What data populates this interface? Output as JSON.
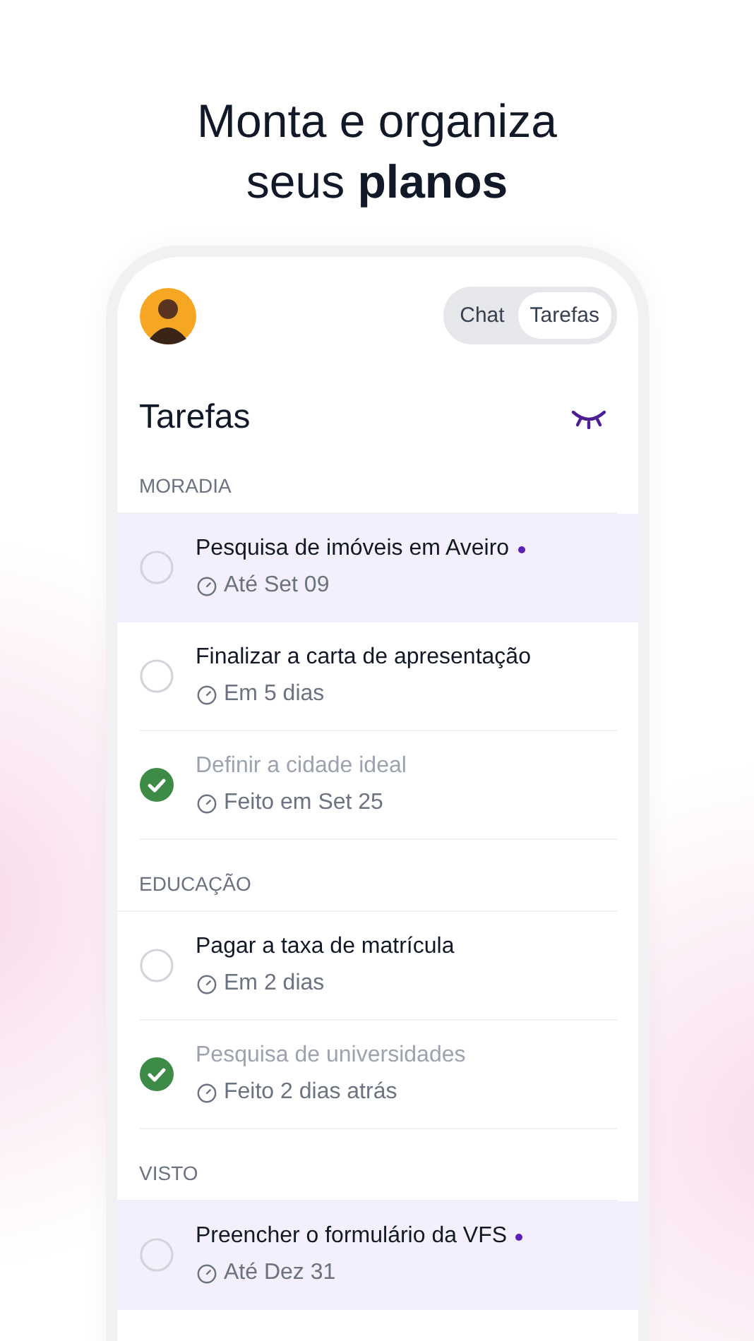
{
  "headline": {
    "line_1": "Monta e organiza",
    "line_2": "seus **planos**"
  },
  "tabs": [
    {
      "label": "Chat",
      "selected": false
    },
    {
      "label": "Tarefas",
      "selected": true
    }
  ],
  "title": "Tarefas",
  "sections": [
    {
      "label": "MORADIA",
      "tasks": [
        {
          "title": "Pesquisa de imóveis em Aveiro",
          "due": "Até Set 09",
          "done": false,
          "highlighted": true,
          "unread": true
        },
        {
          "title": "Finalizar a carta de apresentação",
          "due": "Em 5 dias",
          "done": false,
          "highlighted": false,
          "unread": false
        },
        {
          "title": "Definir a cidade ideal",
          "due": "Feito em Set 25",
          "done": true,
          "highlighted": false,
          "unread": false
        }
      ]
    },
    {
      "label": "EDUCAÇÃO",
      "tasks": [
        {
          "title": "Pagar a taxa de matrícula",
          "due": "Em 2 dias",
          "done": false,
          "highlighted": false,
          "unread": false
        },
        {
          "title": "Pesquisa de universidades",
          "due": "Feito 2 dias atrás",
          "done": true,
          "highlighted": false,
          "unread": false
        }
      ]
    },
    {
      "label": "VISTO",
      "tasks": [
        {
          "title": "Preencher o formulário da VFS",
          "due": "Até Dez 31",
          "done": false,
          "highlighted": true,
          "unread": true
        }
      ]
    }
  ]
}
